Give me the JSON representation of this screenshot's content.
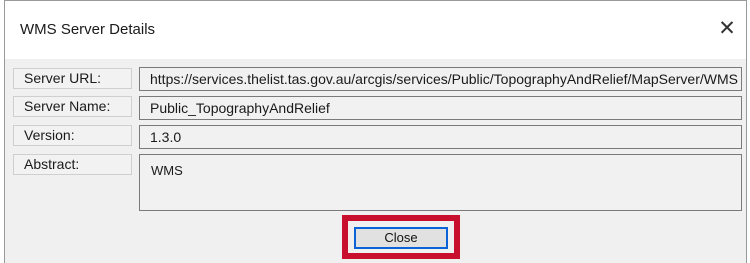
{
  "window": {
    "title": "WMS Server Details",
    "close_glyph": "✕"
  },
  "fields": {
    "server_url": {
      "label": "Server URL:",
      "value": "https://services.thelist.tas.gov.au/arcgis/services/Public/TopographyAndRelief/MapServer/WMS"
    },
    "server_name": {
      "label": "Server Name:",
      "value": "Public_TopographyAndRelief"
    },
    "version": {
      "label": "Version:",
      "value": "1.3.0"
    },
    "abstract": {
      "label": "Abstract:",
      "value": "WMS"
    }
  },
  "buttons": {
    "close_label": "Close"
  },
  "colors": {
    "highlight": "#c8102e",
    "focus_border": "#0a64d6",
    "dialog_bg": "#f0f0f0"
  }
}
